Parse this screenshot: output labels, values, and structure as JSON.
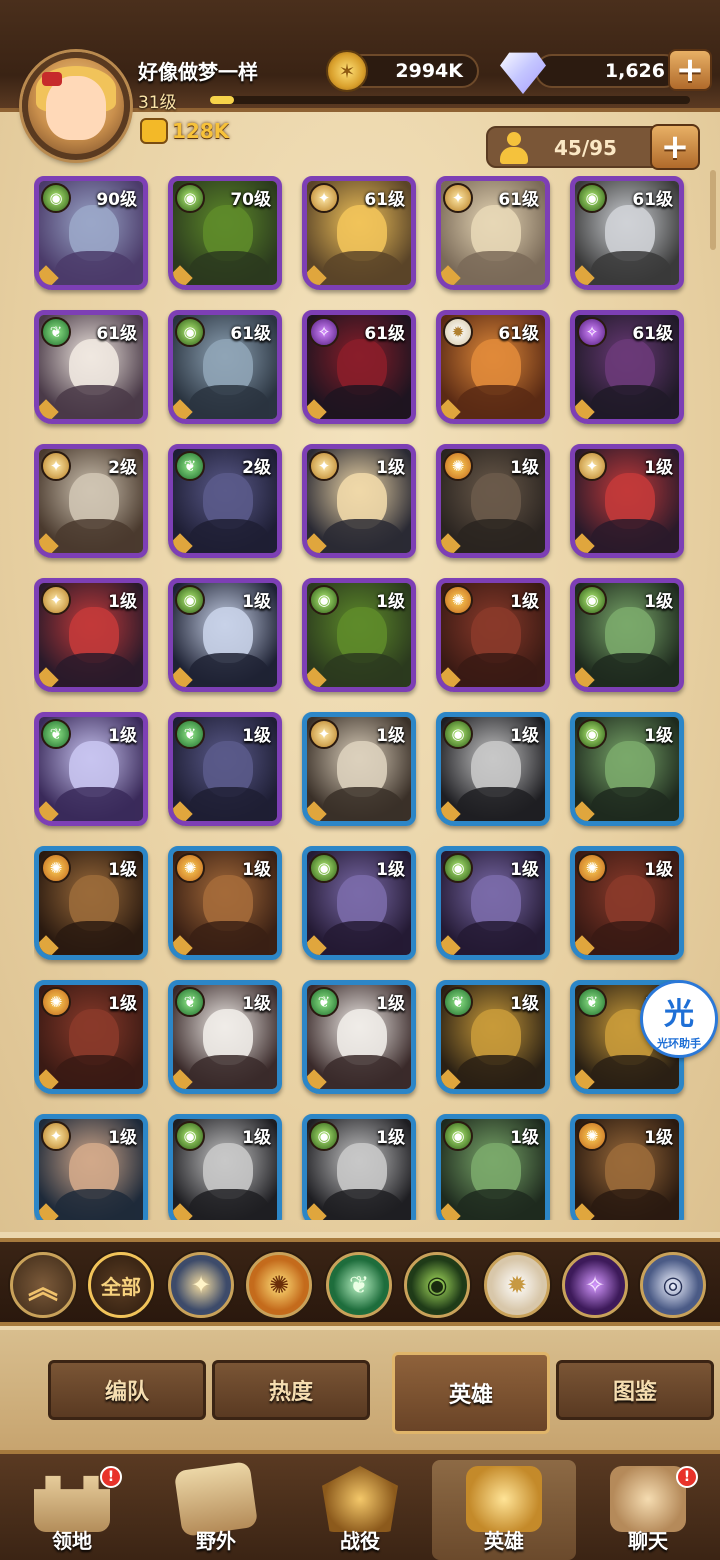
{
  "player": {
    "name": "好像做梦一样",
    "level": "31级",
    "level_progress": 0.05,
    "power": "128K"
  },
  "resources": {
    "gold": "2994K",
    "diamonds": "1,626",
    "diamond_add": "+"
  },
  "roster": {
    "count": "45/95",
    "add": "+"
  },
  "heroes": [
    {
      "level": "90级",
      "faction": "graveborn",
      "frame": "purple",
      "colors": [
        "#4b3b6a",
        "#9aa6c8"
      ]
    },
    {
      "level": "70级",
      "faction": "graveborn",
      "frame": "purple",
      "colors": [
        "#2b3a1e",
        "#5e8b2a"
      ]
    },
    {
      "level": "61级",
      "faction": "lightbearer",
      "frame": "purple",
      "colors": [
        "#5a4428",
        "#f1c35a"
      ]
    },
    {
      "level": "61级",
      "faction": "lightbearer",
      "frame": "purple",
      "colors": [
        "#7a6a58",
        "#e7d7b6"
      ]
    },
    {
      "level": "61级",
      "faction": "graveborn",
      "frame": "purple",
      "colors": [
        "#3a3a3a",
        "#cfd2d6"
      ]
    },
    {
      "level": "61级",
      "faction": "wilder",
      "frame": "purple",
      "colors": [
        "#4a3a48",
        "#f0e8e0"
      ]
    },
    {
      "level": "61级",
      "faction": "graveborn",
      "frame": "purple",
      "colors": [
        "#2a3440",
        "#8fa4b6"
      ]
    },
    {
      "level": "61级",
      "faction": "hypogean",
      "frame": "purple",
      "colors": [
        "#1e1420",
        "#8a1e2a"
      ]
    },
    {
      "level": "61级",
      "faction": "celestial",
      "frame": "purple",
      "colors": [
        "#5a2a14",
        "#e08a3a"
      ]
    },
    {
      "level": "61级",
      "faction": "hypogean",
      "frame": "purple",
      "colors": [
        "#201a28",
        "#6a3a78"
      ]
    },
    {
      "level": "2级",
      "faction": "lightbearer",
      "frame": "purple",
      "colors": [
        "#4a3a2e",
        "#cfc4b2"
      ]
    },
    {
      "level": "2级",
      "faction": "wilder",
      "frame": "purple",
      "colors": [
        "#1e1e34",
        "#5a5a8a"
      ]
    },
    {
      "level": "1级",
      "faction": "lightbearer",
      "frame": "purple",
      "colors": [
        "#2a2a34",
        "#f0d8a8"
      ]
    },
    {
      "level": "1级",
      "faction": "mauler",
      "frame": "purple",
      "colors": [
        "#2a2420",
        "#6a5a4a"
      ]
    },
    {
      "level": "1级",
      "faction": "lightbearer",
      "frame": "purple",
      "colors": [
        "#2a1a2a",
        "#c23a3a"
      ]
    },
    {
      "level": "1级",
      "faction": "lightbearer",
      "frame": "purple",
      "colors": [
        "#2a1a2a",
        "#c23a3a"
      ]
    },
    {
      "level": "1级",
      "faction": "graveborn",
      "frame": "purple",
      "colors": [
        "#1e2234",
        "#c8d2e8"
      ]
    },
    {
      "level": "1级",
      "faction": "graveborn",
      "frame": "purple",
      "colors": [
        "#2b3a1e",
        "#5e8b2a"
      ]
    },
    {
      "level": "1级",
      "faction": "mauler",
      "frame": "purple",
      "colors": [
        "#3a1a14",
        "#8a3a2a"
      ]
    },
    {
      "level": "1级",
      "faction": "graveborn",
      "frame": "purple",
      "colors": [
        "#1e2a1e",
        "#7aa86a"
      ]
    },
    {
      "level": "1级",
      "faction": "wilder",
      "frame": "purple",
      "colors": [
        "#3a2a5a",
        "#c8c4f0"
      ]
    },
    {
      "level": "1级",
      "faction": "wilder",
      "frame": "purple",
      "colors": [
        "#1e1e34",
        "#5a5a8a"
      ]
    },
    {
      "level": "1级",
      "faction": "lightbearer",
      "frame": "blue",
      "colors": [
        "#3a3028",
        "#dcd0bc"
      ]
    },
    {
      "level": "1级",
      "faction": "graveborn",
      "frame": "blue",
      "colors": [
        "#1e1e22",
        "#c8c8c8"
      ]
    },
    {
      "level": "1级",
      "faction": "graveborn",
      "frame": "blue",
      "colors": [
        "#1e2a1e",
        "#7aa86a"
      ]
    },
    {
      "level": "1级",
      "faction": "mauler",
      "frame": "blue",
      "colors": [
        "#2a1a10",
        "#9a6a3a"
      ]
    },
    {
      "level": "1级",
      "faction": "mauler",
      "frame": "blue",
      "colors": [
        "#3a2014",
        "#a46a3a"
      ]
    },
    {
      "level": "1级",
      "faction": "graveborn",
      "frame": "blue",
      "colors": [
        "#241a34",
        "#7a6aa8"
      ]
    },
    {
      "level": "1级",
      "faction": "graveborn",
      "frame": "blue",
      "colors": [
        "#241a34",
        "#7a6aa8"
      ]
    },
    {
      "level": "1级",
      "faction": "mauler",
      "frame": "blue",
      "colors": [
        "#3a1a14",
        "#8a3a2a"
      ]
    },
    {
      "level": "1级",
      "faction": "mauler",
      "frame": "blue",
      "colors": [
        "#3a1a14",
        "#8a3a2a"
      ]
    },
    {
      "level": "1级",
      "faction": "wilder",
      "frame": "blue",
      "colors": [
        "#3a2a2a",
        "#f0ece8"
      ]
    },
    {
      "level": "1级",
      "faction": "wilder",
      "frame": "blue",
      "colors": [
        "#3a2a2a",
        "#f0ece8"
      ]
    },
    {
      "level": "1级",
      "faction": "wilder",
      "frame": "blue",
      "colors": [
        "#2a2014",
        "#c89a3a"
      ]
    },
    {
      "level": "1级",
      "faction": "wilder",
      "frame": "blue",
      "colors": [
        "#2a2014",
        "#c89a3a"
      ]
    },
    {
      "level": "1级",
      "faction": "lightbearer",
      "frame": "blue",
      "colors": [
        "#1e2a3a",
        "#d2a88a"
      ]
    },
    {
      "level": "1级",
      "faction": "graveborn",
      "frame": "blue",
      "colors": [
        "#1e1e22",
        "#c8c8c8"
      ]
    },
    {
      "level": "1级",
      "faction": "graveborn",
      "frame": "blue",
      "colors": [
        "#1e1e22",
        "#c8c8c8"
      ]
    },
    {
      "level": "1级",
      "faction": "graveborn",
      "frame": "blue",
      "colors": [
        "#1e2a1e",
        "#7aa86a"
      ]
    },
    {
      "level": "1级",
      "faction": "mauler",
      "frame": "blue",
      "colors": [
        "#2a1a10",
        "#9a6a3a"
      ]
    }
  ],
  "faction_filters": {
    "collapse_icon": "double-chevron-up-icon",
    "all_label": "全部",
    "items": [
      "lightbearer",
      "mauler",
      "wilder",
      "graveborn",
      "celestial",
      "hypogean",
      "dimensional"
    ]
  },
  "sub_tabs": [
    {
      "label": "编队",
      "active": false
    },
    {
      "label": "热度",
      "active": false
    },
    {
      "label": "英雄",
      "active": true
    },
    {
      "label": "图鉴",
      "active": false
    }
  ],
  "bottom_nav": [
    {
      "label": "领地",
      "icon": "castle-icon",
      "badge": "!",
      "active": false
    },
    {
      "label": "野外",
      "icon": "scroll-icon",
      "badge": "",
      "active": false
    },
    {
      "label": "战役",
      "icon": "swords-icon",
      "badge": "",
      "active": false
    },
    {
      "label": "英雄",
      "icon": "helmet-icon",
      "badge": "",
      "active": true
    },
    {
      "label": "聊天",
      "icon": "chat-icon",
      "badge": "!",
      "active": false
    }
  ],
  "assistant": {
    "glyph": "光",
    "name": "光环助手"
  },
  "colors": {
    "purple_frame": "#7d3fb5",
    "blue_frame": "#2c86c7",
    "gold_text": "#f7c23a",
    "badge_red": "#e8322a"
  }
}
